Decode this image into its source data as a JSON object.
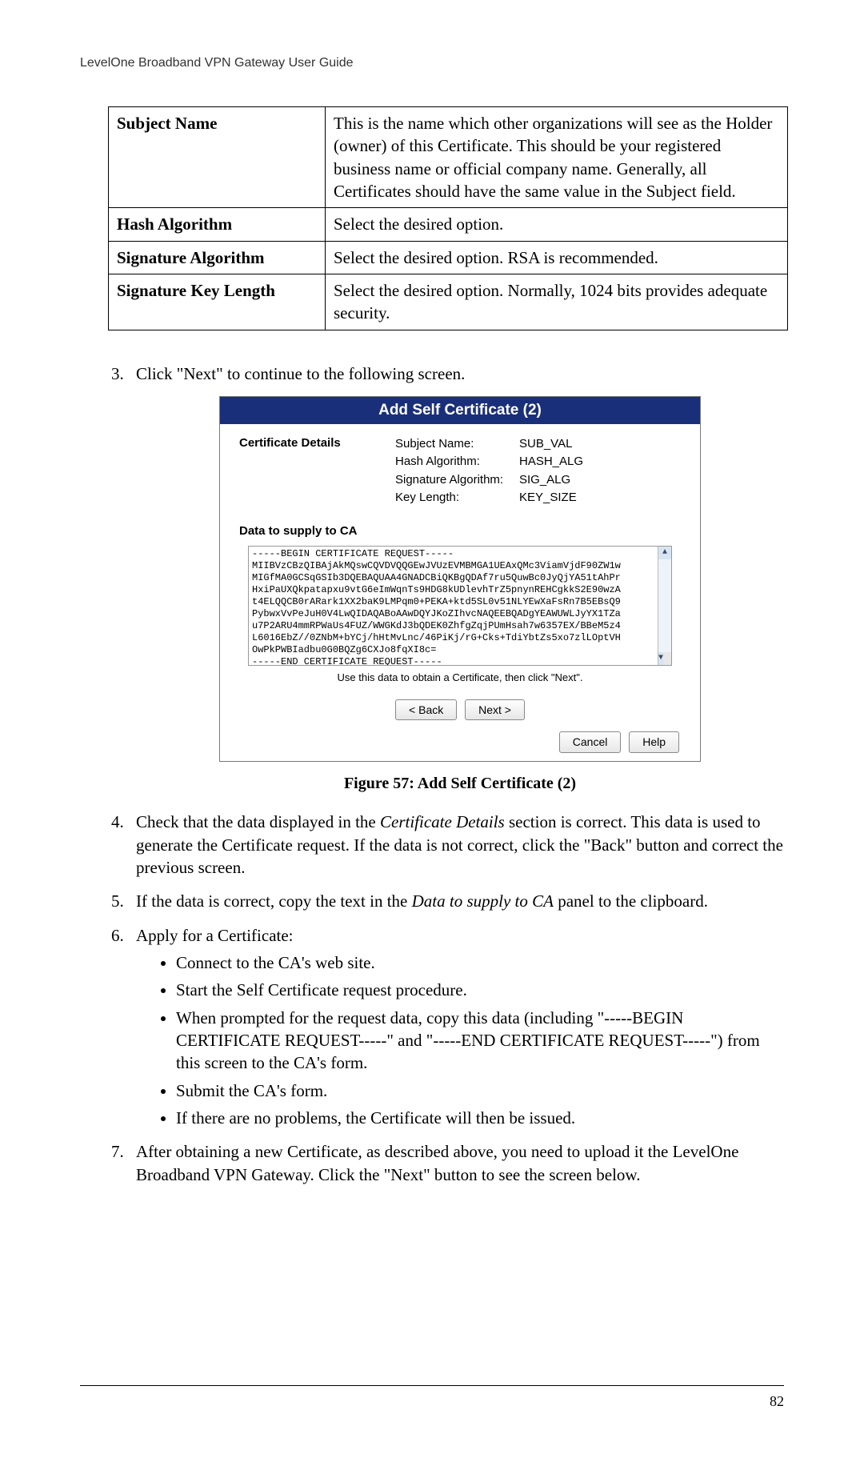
{
  "header": "LevelOne Broadband VPN Gateway User Guide",
  "table": {
    "rows": [
      {
        "label": "Subject Name",
        "desc": "This is the name which other organizations will see as the Holder (owner) of this Certificate. This should be your registered business name or official company name.  Generally, all Certificates should have the same value in the Subject field."
      },
      {
        "label": "Hash Algorithm",
        "desc": "Select the desired option."
      },
      {
        "label": "Signature Algorithm",
        "desc": "Select the desired option. RSA is recommended."
      },
      {
        "label": "Signature Key Length",
        "desc": "Select the desired option. Normally, 1024 bits provides adequate security."
      }
    ]
  },
  "step3": "Click \"Next\" to continue to the following screen.",
  "dialog": {
    "title": "Add Self Certificate (2)",
    "cert_details_label": "Certificate Details",
    "fields": [
      {
        "k": "Subject Name:",
        "v": "SUB_VAL"
      },
      {
        "k": "Hash Algorithm:",
        "v": "HASH_ALG"
      },
      {
        "k": "Signature Algorithm:",
        "v": "SIG_ALG"
      },
      {
        "k": "Key Length:",
        "v": "KEY_SIZE"
      }
    ],
    "data_label": "Data to supply to CA",
    "csr": "-----BEGIN CERTIFICATE REQUEST-----\nMIIBVzCBzQIBAjAkMQswCQVDVQQGEwJVUzEVMBMGA1UEAxQMc3ViamVjdF90ZW1w\nMIGfMA0GCSqGSIb3DQEBAQUAA4GNADCBiQKBgQDAf7ru5QuwBc0JyQjYA51tAhPr\nHxiPaUXQkpatapxu9vtG6eImWqnTs9HDG8kUDlevhTrZ5pnynREHCgkkS2E90wzA\nt4ELQQCB0rARark1XX2baK9LMPqm0+PEKA+ktd5SL0v51NLYEwXaFsRn7B5EBsQ9\nPybwxVvPeJuH0V4LwQIDAQABoAAwDQYJKoZIhvcNAQEEBQADgYEAWUWLJyYX1TZa\nu7P2ARU4mmRPWaUs4FUZ/WWGKdJ3bQDEK0ZhfgZqjPUmHsah7w6357EX/BBeM5z4\nL6016EbZ//0ZNbM+bYCj/hHtMvLnc/46PiKj/rG+Cks+TdiYbtZs5xo7zlLOptVH\nOwPkPWBIadbu0G0BQZg6CXJo8fqXI8c=\n-----END CERTIFICATE REQUEST-----",
    "hint": "Use this data to obtain a Certificate, then click \"Next\".",
    "back": "< Back",
    "next": "Next >",
    "cancel": "Cancel",
    "help": "Help"
  },
  "figcaption": "Figure 57: Add Self Certificate (2)",
  "step4_a": "Check that the data displayed in the ",
  "step4_i": "Certificate Details",
  "step4_b": " section is correct. This data is used to generate the Certificate request. If the data is not correct, click the \"Back\" button and correct the previous screen.",
  "step5_a": "If the data is correct, copy the text in the ",
  "step5_i": "Data to supply to CA",
  "step5_b": " panel to the clipboard.",
  "step6": "Apply for a Certificate:",
  "step6_bullets": [
    "Connect to the CA's web site.",
    "Start the Self Certificate request procedure.",
    "When prompted for the request data, copy this data (including \"-----BEGIN CERTIFICATE REQUEST-----\" and \"-----END CERTIFICATE REQUEST-----\") from this screen to the CA's form.",
    "Submit the CA's form.",
    "If there are no problems, the Certificate will then be issued."
  ],
  "step7": "After obtaining a new Certificate, as described above, you need to upload it the LevelOne Broadband VPN Gateway. Click the \"Next\" button to see the screen below.",
  "page_num": "82"
}
